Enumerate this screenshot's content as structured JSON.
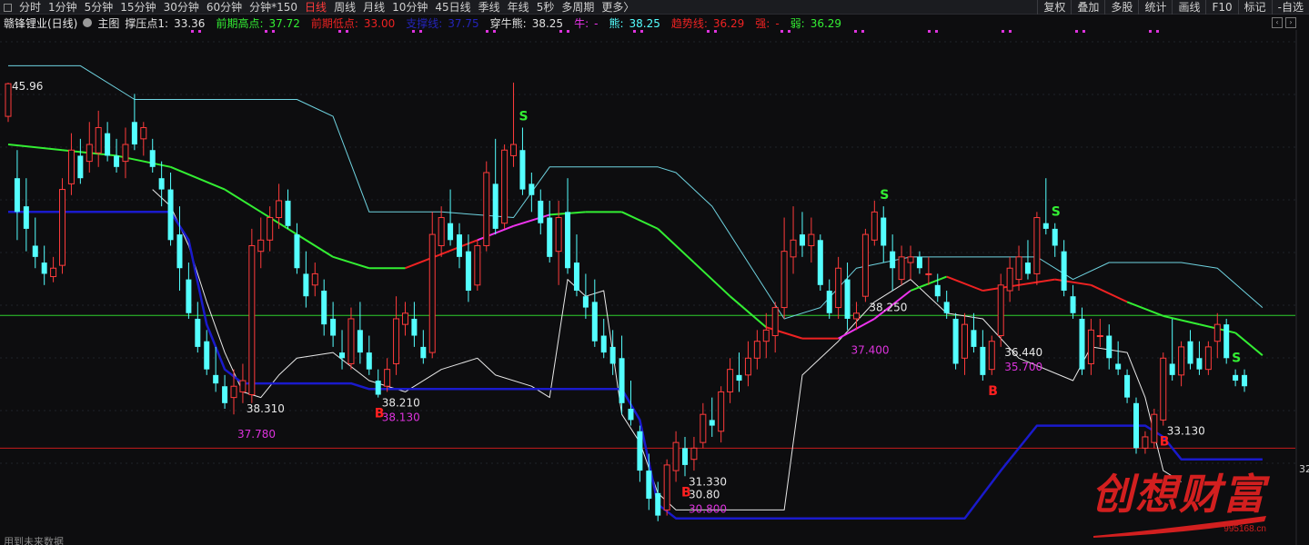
{
  "toolbar": {
    "periods": [
      "分时",
      "1分钟",
      "5分钟",
      "15分钟",
      "30分钟",
      "60分钟",
      "分钟*150",
      "日线",
      "周线",
      "月线",
      "10分钟",
      "45日线",
      "季线",
      "年线",
      "5秒",
      "多周期",
      "更多〉"
    ],
    "active_period": "日线",
    "right_buttons": [
      "复权",
      "叠加",
      "多股",
      "统计",
      "画线",
      "F10",
      "标记",
      "-自选"
    ]
  },
  "header": {
    "stock_name": "赣锋锂业(日线)",
    "main_label": "主图",
    "pressure_label": "撑压点1:",
    "pressure_value": "33.36",
    "prev_high_label": "前期高点:",
    "prev_high_value": "37.72",
    "prev_low_label": "前期低点:",
    "prev_low_value": "33.00",
    "obscured_label": "支撑线:",
    "obscured_value": "37.75",
    "bull_bear_label": "穿牛熊:",
    "bull_bear_value": "38.25",
    "bull_label": "牛:",
    "bull_value": "-",
    "bear_label": "熊:",
    "bear_value": "38.25",
    "trend_label": "趋势线:",
    "trend_value": "36.29",
    "strong_label": "强:",
    "strong_value": "-",
    "weak_label": "弱:",
    "weak_value": "36.29"
  },
  "colors": {
    "up": "#ff3b3b",
    "down": "#54ffff",
    "ma_green": "#33ee33",
    "ma_red": "#ee2222",
    "ma_magenta": "#ee33ee",
    "stop_blue": "#1a1acc",
    "band_cyan": "#6fd3e0",
    "hline_green": "#2fcf2f",
    "hline_red": "#c81d1d",
    "label_magenta": "#dd33dd",
    "signal_s": "#33ee33",
    "signal_b": "#ff2020"
  },
  "chart_data": {
    "type": "candlestick",
    "title": "赣锋锂业(日线)",
    "price_range": [
      30.2,
      47.0
    ],
    "candles": [
      [
        44.8,
        46.0,
        44.6,
        45.96
      ],
      [
        42.6,
        43.6,
        40.4,
        41.4
      ],
      [
        41.6,
        42.6,
        40.0,
        40.8
      ],
      [
        40.2,
        41.2,
        39.4,
        39.8
      ],
      [
        39.6,
        40.2,
        38.8,
        39.2
      ],
      [
        39.1,
        39.8,
        38.9,
        39.4
      ],
      [
        39.5,
        42.6,
        39.2,
        42.2
      ],
      [
        42.4,
        44.2,
        42.0,
        43.6
      ],
      [
        43.4,
        44.0,
        42.4,
        42.6
      ],
      [
        43.2,
        44.6,
        42.8,
        43.8
      ],
      [
        43.5,
        45.0,
        43.0,
        44.4
      ],
      [
        44.2,
        44.6,
        43.2,
        43.4
      ],
      [
        43.4,
        44.0,
        42.8,
        43.0
      ],
      [
        43.2,
        44.4,
        42.6,
        43.8
      ],
      [
        44.6,
        45.6,
        43.6,
        43.8
      ],
      [
        44.0,
        44.6,
        43.4,
        44.4
      ],
      [
        43.6,
        44.0,
        42.8,
        43.0
      ],
      [
        42.6,
        43.2,
        41.6,
        42.2
      ],
      [
        42.2,
        42.8,
        40.2,
        40.4
      ],
      [
        40.6,
        41.6,
        38.6,
        39.4
      ],
      [
        39.0,
        39.6,
        37.6,
        37.8
      ],
      [
        37.6,
        38.2,
        36.4,
        36.6
      ],
      [
        36.8,
        37.2,
        35.6,
        35.8
      ],
      [
        35.6,
        36.6,
        35.0,
        35.3
      ],
      [
        35.2,
        35.6,
        34.4,
        34.6
      ],
      [
        34.8,
        35.8,
        34.2,
        35.2
      ],
      [
        35.0,
        36.0,
        34.6,
        35.4
      ],
      [
        34.9,
        40.8,
        34.6,
        40.2
      ],
      [
        40.0,
        41.2,
        39.4,
        40.4
      ],
      [
        40.4,
        41.6,
        40.0,
        41.2
      ],
      [
        41.2,
        42.4,
        40.8,
        41.8
      ],
      [
        41.8,
        42.2,
        40.8,
        40.9
      ],
      [
        40.6,
        41.0,
        39.2,
        39.4
      ],
      [
        39.2,
        40.0,
        38.0,
        38.4
      ],
      [
        38.8,
        39.6,
        38.4,
        39.2
      ],
      [
        38.6,
        39.0,
        37.0,
        37.4
      ],
      [
        37.6,
        38.2,
        36.6,
        37.0
      ],
      [
        36.4,
        37.2,
        35.8,
        36.2
      ],
      [
        36.0,
        38.0,
        35.8,
        37.6
      ],
      [
        37.2,
        38.2,
        36.0,
        36.4
      ],
      [
        36.4,
        37.0,
        35.6,
        35.8
      ],
      [
        35.4,
        35.8,
        34.8,
        34.9
      ],
      [
        35.2,
        36.2,
        35.0,
        35.8
      ],
      [
        36.0,
        38.4,
        35.6,
        37.6
      ],
      [
        37.4,
        38.2,
        37.0,
        37.8
      ],
      [
        37.6,
        38.2,
        36.6,
        37.0
      ],
      [
        36.6,
        37.2,
        36.0,
        36.2
      ],
      [
        36.4,
        41.4,
        36.2,
        40.6
      ],
      [
        40.2,
        41.6,
        39.8,
        41.2
      ],
      [
        41.0,
        42.2,
        40.2,
        40.4
      ],
      [
        40.6,
        41.0,
        39.4,
        39.8
      ],
      [
        40.0,
        40.6,
        38.2,
        38.6
      ],
      [
        38.8,
        40.4,
        38.6,
        40.2
      ],
      [
        40.2,
        43.2,
        40.0,
        42.8
      ],
      [
        42.4,
        44.0,
        40.6,
        40.8
      ],
      [
        41.0,
        43.8,
        40.8,
        43.6
      ],
      [
        43.4,
        46.0,
        43.0,
        43.8
      ],
      [
        43.6,
        44.4,
        42.0,
        42.2
      ],
      [
        42.4,
        42.8,
        41.4,
        42.0
      ],
      [
        41.8,
        42.2,
        40.6,
        41.0
      ],
      [
        41.2,
        41.8,
        39.6,
        39.8
      ],
      [
        40.0,
        41.8,
        38.8,
        41.2
      ],
      [
        41.4,
        42.6,
        39.2,
        39.4
      ],
      [
        39.6,
        40.6,
        38.4,
        38.6
      ],
      [
        38.4,
        39.2,
        37.6,
        38.0
      ],
      [
        38.2,
        39.0,
        36.6,
        36.8
      ],
      [
        37.0,
        37.6,
        36.2,
        36.4
      ],
      [
        36.6,
        37.2,
        35.6,
        36.0
      ],
      [
        36.2,
        37.0,
        34.2,
        34.6
      ],
      [
        34.4,
        35.4,
        33.8,
        34.0
      ],
      [
        33.6,
        33.8,
        31.8,
        32.2
      ],
      [
        32.2,
        32.8,
        30.8,
        31.2
      ],
      [
        31.4,
        31.8,
        30.4,
        30.6
      ],
      [
        30.8,
        32.6,
        30.6,
        32.4
      ],
      [
        32.2,
        33.6,
        31.8,
        33.2
      ],
      [
        33.0,
        33.4,
        32.0,
        32.4
      ],
      [
        32.6,
        33.4,
        32.2,
        33.0
      ],
      [
        33.2,
        34.6,
        33.0,
        34.2
      ],
      [
        34.0,
        34.8,
        33.4,
        33.8
      ],
      [
        33.6,
        35.2,
        33.2,
        35.0
      ],
      [
        35.0,
        36.2,
        34.6,
        35.8
      ],
      [
        35.6,
        36.4,
        35.0,
        35.4
      ],
      [
        35.6,
        36.8,
        35.2,
        36.2
      ],
      [
        36.2,
        37.2,
        35.8,
        36.8
      ],
      [
        36.8,
        37.8,
        36.2,
        37.2
      ],
      [
        37.0,
        38.2,
        36.4,
        38.0
      ],
      [
        38.0,
        41.2,
        37.6,
        40.0
      ],
      [
        39.8,
        41.6,
        39.2,
        40.4
      ],
      [
        40.6,
        41.4,
        39.8,
        40.2
      ],
      [
        40.2,
        41.2,
        39.6,
        40.6
      ],
      [
        40.4,
        40.6,
        38.6,
        38.8
      ],
      [
        38.6,
        39.0,
        37.6,
        37.8
      ],
      [
        38.0,
        39.8,
        37.6,
        39.4
      ],
      [
        39.0,
        39.6,
        37.2,
        37.6
      ],
      [
        37.6,
        38.2,
        37.2,
        37.8
      ],
      [
        38.4,
        40.8,
        38.2,
        40.6
      ],
      [
        40.4,
        41.8,
        40.2,
        41.4
      ],
      [
        41.2,
        41.6,
        39.6,
        40.2
      ],
      [
        40.0,
        40.6,
        38.6,
        39.4
      ],
      [
        39.0,
        40.2,
        38.8,
        39.8
      ],
      [
        39.6,
        40.2,
        39.0,
        39.8
      ],
      [
        39.8,
        40.0,
        39.2,
        39.4
      ],
      [
        39.2,
        39.8,
        38.8,
        39.2
      ],
      [
        38.8,
        39.2,
        38.2,
        38.4
      ],
      [
        38.2,
        38.6,
        37.6,
        37.8
      ],
      [
        37.6,
        37.8,
        35.8,
        36.0
      ],
      [
        36.2,
        37.8,
        35.6,
        37.4
      ],
      [
        37.2,
        37.8,
        36.4,
        36.6
      ],
      [
        36.6,
        37.2,
        35.4,
        35.6
      ],
      [
        35.8,
        37.0,
        35.6,
        36.8
      ],
      [
        37.0,
        39.2,
        36.6,
        38.8
      ],
      [
        38.6,
        39.8,
        38.2,
        39.4
      ],
      [
        39.0,
        40.2,
        38.6,
        39.8
      ],
      [
        39.6,
        40.4,
        39.0,
        39.2
      ],
      [
        39.2,
        41.4,
        38.8,
        41.2
      ],
      [
        41.0,
        42.6,
        40.6,
        40.8
      ],
      [
        40.8,
        41.0,
        39.8,
        40.2
      ],
      [
        40.0,
        40.4,
        38.4,
        38.6
      ],
      [
        38.4,
        38.8,
        37.6,
        37.8
      ],
      [
        37.6,
        38.0,
        35.6,
        35.8
      ],
      [
        36.0,
        37.6,
        35.6,
        37.2
      ],
      [
        37.0,
        37.6,
        36.6,
        37.0
      ],
      [
        37.0,
        37.4,
        35.8,
        36.2
      ],
      [
        36.0,
        36.8,
        35.6,
        35.8
      ],
      [
        35.6,
        35.8,
        34.6,
        34.8
      ],
      [
        34.6,
        34.8,
        32.8,
        33.0
      ],
      [
        33.0,
        33.6,
        32.8,
        33.4
      ],
      [
        33.2,
        34.4,
        33.0,
        34.2
      ],
      [
        34.0,
        36.4,
        33.8,
        36.2
      ],
      [
        36.0,
        37.6,
        35.4,
        35.6
      ],
      [
        35.6,
        36.8,
        35.2,
        36.6
      ],
      [
        36.8,
        37.2,
        35.8,
        36.0
      ],
      [
        36.2,
        36.8,
        35.6,
        35.8
      ],
      [
        35.8,
        36.8,
        35.6,
        36.6
      ],
      [
        36.8,
        37.8,
        36.2,
        37.4
      ],
      [
        37.4,
        37.6,
        36.0,
        36.2
      ],
      [
        35.6,
        35.8,
        35.2,
        35.4
      ],
      [
        35.6,
        35.8,
        35.0,
        35.2
      ]
    ],
    "labels": [
      {
        "i": 0,
        "text": "45.96",
        "kind": "price"
      },
      {
        "i": 26,
        "text": "38.310",
        "kind": "price"
      },
      {
        "i": 25,
        "text": "37.780",
        "kind": "low"
      },
      {
        "i": 41,
        "text": "38.210",
        "kind": "price"
      },
      {
        "i": 41,
        "text": "38.130",
        "kind": "low"
      },
      {
        "i": 95,
        "text": "38.250",
        "kind": "price"
      },
      {
        "i": 93,
        "text": "37.400",
        "kind": "low"
      },
      {
        "i": 110,
        "text": "36.440",
        "kind": "price"
      },
      {
        "i": 110,
        "text": "35.700",
        "kind": "low"
      },
      {
        "i": 128,
        "text": "33.130",
        "kind": "price"
      },
      {
        "i": 75,
        "text": "31.330",
        "kind": "price"
      },
      {
        "i": 75,
        "text": "30.80",
        "kind": "price"
      },
      {
        "i": 75,
        "text": "30.800",
        "kind": "low"
      }
    ],
    "signals": [
      {
        "i": 57,
        "text": "S",
        "kind": "sell"
      },
      {
        "i": 97,
        "text": "S",
        "kind": "sell"
      },
      {
        "i": 116,
        "text": "S",
        "kind": "sell"
      },
      {
        "i": 136,
        "text": "S",
        "kind": "sell"
      },
      {
        "i": 41,
        "text": "B",
        "kind": "buy"
      },
      {
        "i": 109,
        "text": "B",
        "kind": "buy"
      },
      {
        "i": 128,
        "text": "B",
        "kind": "buy"
      },
      {
        "i": 75,
        "text": "B",
        "kind": "buy"
      }
    ],
    "hlines": [
      {
        "value": 37.72,
        "color": "hline_green"
      },
      {
        "value": 33.0,
        "color": "hline_red"
      }
    ],
    "blue_stop": [
      [
        0,
        41.4
      ],
      [
        18,
        41.4
      ],
      [
        20,
        40.4
      ],
      [
        22,
        37.4
      ],
      [
        24,
        35.8
      ],
      [
        26,
        35.3
      ],
      [
        38,
        35.3
      ],
      [
        40,
        35.1
      ],
      [
        68,
        35.1
      ],
      [
        70,
        34.0
      ],
      [
        72,
        31.0
      ],
      [
        74,
        30.5
      ],
      [
        106,
        30.5
      ],
      [
        110,
        32.2
      ],
      [
        114,
        33.8
      ],
      [
        126,
        33.8
      ],
      [
        128,
        33.4
      ],
      [
        130,
        32.6
      ],
      [
        139,
        32.6
      ]
    ],
    "ma_line": [
      [
        0,
        43.8
      ],
      [
        6,
        43.6
      ],
      [
        12,
        43.4
      ],
      [
        18,
        43.0
      ],
      [
        24,
        42.2
      ],
      [
        28,
        41.4
      ],
      [
        32,
        40.6
      ],
      [
        36,
        39.8
      ],
      [
        40,
        39.4
      ],
      [
        44,
        39.4
      ],
      [
        48,
        39.9
      ],
      [
        52,
        40.4
      ],
      [
        56,
        40.9
      ],
      [
        60,
        41.3
      ],
      [
        64,
        41.4
      ],
      [
        68,
        41.4
      ],
      [
        72,
        40.8
      ],
      [
        76,
        39.6
      ],
      [
        80,
        38.4
      ],
      [
        84,
        37.3
      ],
      [
        88,
        36.9
      ],
      [
        92,
        36.9
      ],
      [
        96,
        37.6
      ],
      [
        100,
        38.6
      ],
      [
        104,
        39.1
      ],
      [
        108,
        38.6
      ],
      [
        112,
        38.8
      ],
      [
        116,
        39.0
      ],
      [
        120,
        38.8
      ],
      [
        124,
        38.2
      ],
      [
        128,
        37.7
      ],
      [
        132,
        37.4
      ],
      [
        136,
        37.1
      ],
      [
        139,
        36.3
      ]
    ],
    "upper_band": [
      [
        0,
        46.6
      ],
      [
        8,
        46.6
      ],
      [
        14,
        45.4
      ],
      [
        26,
        45.4
      ],
      [
        32,
        45.4
      ],
      [
        36,
        44.8
      ],
      [
        40,
        41.4
      ],
      [
        48,
        41.4
      ],
      [
        56,
        41.2
      ],
      [
        60,
        43.0
      ],
      [
        72,
        43.0
      ],
      [
        74,
        42.8
      ],
      [
        78,
        41.6
      ],
      [
        82,
        39.6
      ],
      [
        86,
        37.6
      ],
      [
        90,
        38.0
      ],
      [
        94,
        39.4
      ],
      [
        100,
        39.8
      ],
      [
        110,
        39.8
      ],
      [
        114,
        39.8
      ],
      [
        118,
        39.0
      ],
      [
        122,
        39.6
      ],
      [
        130,
        39.6
      ],
      [
        134,
        39.4
      ],
      [
        139,
        38.0
      ]
    ],
    "white_line": [
      [
        16,
        42.2
      ],
      [
        18,
        41.6
      ],
      [
        20,
        40.2
      ],
      [
        22,
        38.2
      ],
      [
        24,
        36.4
      ],
      [
        26,
        35.0
      ],
      [
        28,
        34.8
      ],
      [
        30,
        35.6
      ],
      [
        32,
        36.2
      ],
      [
        36,
        36.4
      ],
      [
        40,
        35.4
      ],
      [
        44,
        35.0
      ],
      [
        48,
        35.8
      ],
      [
        52,
        36.2
      ],
      [
        54,
        35.6
      ],
      [
        58,
        35.2
      ],
      [
        60,
        34.8
      ],
      [
        62,
        39.0
      ],
      [
        64,
        38.4
      ],
      [
        66,
        38.6
      ],
      [
        68,
        34.2
      ],
      [
        70,
        33.2
      ],
      [
        72,
        31.4
      ],
      [
        74,
        30.8
      ],
      [
        86,
        30.8
      ],
      [
        88,
        35.6
      ],
      [
        92,
        36.8
      ],
      [
        96,
        38.2
      ],
      [
        100,
        39.0
      ],
      [
        104,
        37.8
      ],
      [
        108,
        37.6
      ],
      [
        112,
        36.2
      ],
      [
        118,
        35.4
      ],
      [
        120,
        36.6
      ],
      [
        124,
        36.4
      ],
      [
        126,
        34.8
      ],
      [
        128,
        32.2
      ],
      [
        130,
        31.8
      ]
    ],
    "x_dots_count": 14
  },
  "footer_note": "用到未来数据",
  "right_price": "32",
  "scroll_ctrl": [
    "‹",
    "›"
  ],
  "watermark": {
    "text": "创想财富",
    "url": "995168.cn"
  }
}
